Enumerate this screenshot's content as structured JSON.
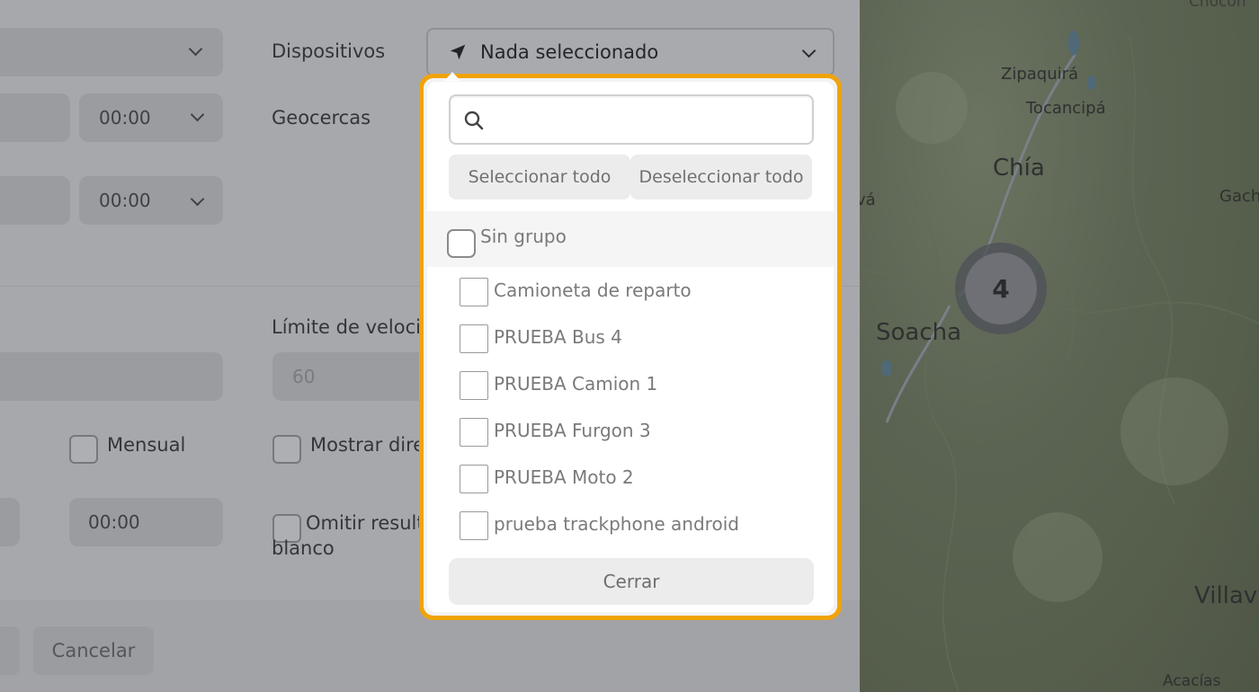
{
  "form": {
    "time_1": "00:00",
    "time_2": "00:00",
    "time_3": "00:00",
    "speed_value": "60",
    "labels": {
      "dispositivos": "Dispositivos",
      "geocercas": "Geocercas",
      "speed_limit": "Límite de velocida",
      "monthly": "Mensual",
      "show_dir": "Mostrar dire",
      "omit_line1": "Omitir resulta",
      "omit_line2": "blanco"
    },
    "cancel_label": "Cancelar"
  },
  "device_select": {
    "icon": "navigation-arrow-icon",
    "value": "Nada seleccionado"
  },
  "dropdown": {
    "search_icon": "search-icon",
    "search_value": "",
    "select_all": "Seleccionar todo",
    "deselect_all": "Deseleccionar todo",
    "group_label": "Sin grupo",
    "items": [
      {
        "label": "Camioneta de reparto"
      },
      {
        "label": "PRUEBA Bus 4"
      },
      {
        "label": "PRUEBA Camion 1"
      },
      {
        "label": "PRUEBA Furgon 3"
      },
      {
        "label": "PRUEBA Moto 2"
      },
      {
        "label": "prueba trackphone android"
      }
    ],
    "close_label": "Cerrar",
    "highlight_color": "#f0a30a"
  },
  "map": {
    "labels": {
      "chocon": "Chocon",
      "zipaquira": "Zipaquirá",
      "tocancipa": "Tocancipá",
      "chia": "Chía",
      "gach": "Gach",
      "va": "vá",
      "soacha": "Soacha",
      "villavi": "Villavi",
      "acacias": "Acacías"
    },
    "cluster_count": "4"
  }
}
